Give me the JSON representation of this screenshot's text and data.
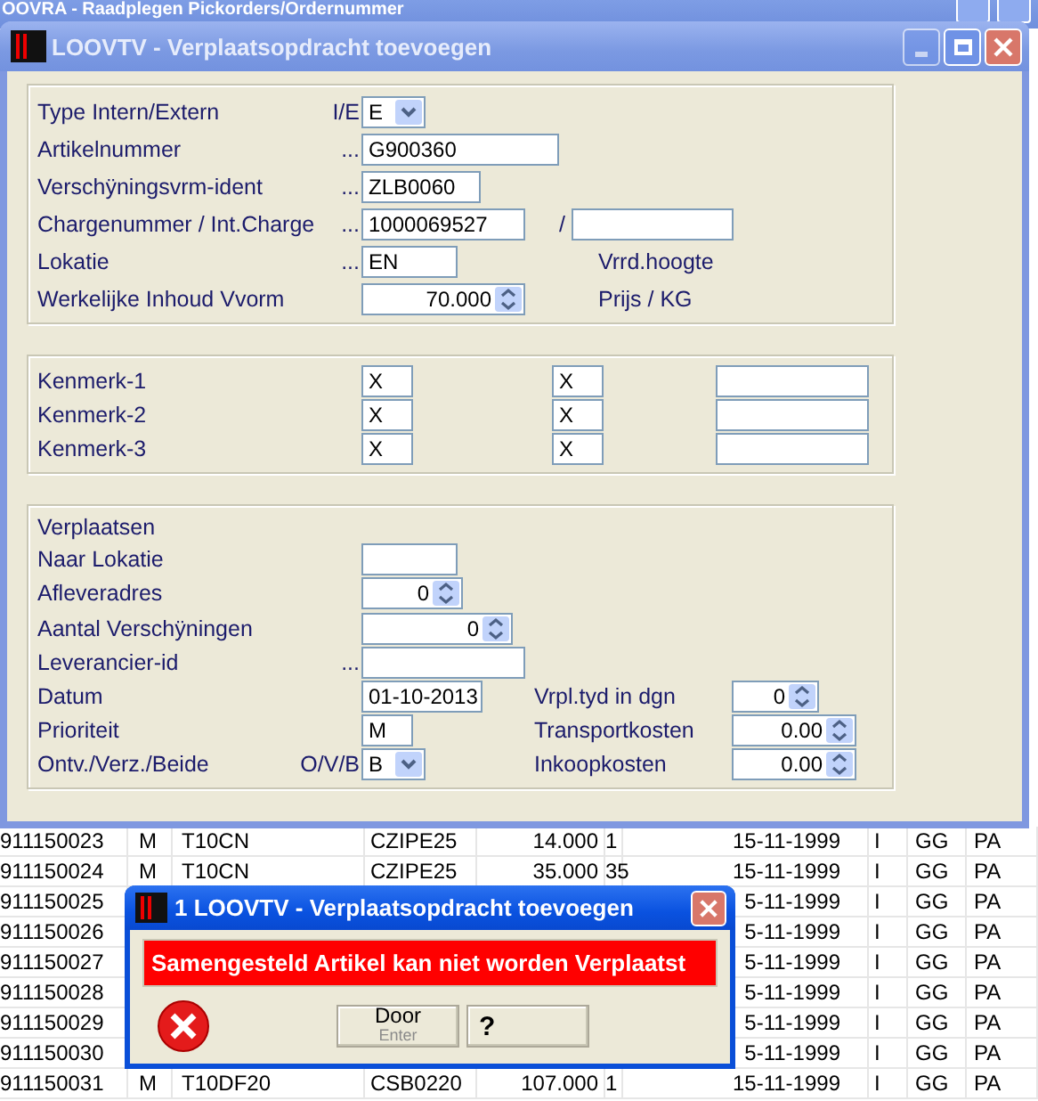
{
  "background_window": {
    "title": "OOVRA - Raadplegen Pickorders/Ordernummer"
  },
  "table": {
    "rows": [
      {
        "id": "911150023",
        "type": "M",
        "article": "T10CN",
        "code": "CZIPE25",
        "qty": "14.000",
        "count": "1",
        "date": "15-11-1999",
        "flag": "I",
        "group": "GG",
        "loc": "PA"
      },
      {
        "id": "911150024",
        "type": "M",
        "article": "T10CN",
        "code": "CZIPE25",
        "qty": "35.000",
        "count": "35",
        "date": "15-11-1999",
        "flag": "I",
        "group": "GG",
        "loc": "PA"
      },
      {
        "id": "911150025",
        "date": "5-11-1999",
        "flag": "I",
        "group": "GG",
        "loc": "PA"
      },
      {
        "id": "911150026",
        "date": "5-11-1999",
        "flag": "I",
        "group": "GG",
        "loc": "PA"
      },
      {
        "id": "911150027",
        "date": "5-11-1999",
        "flag": "I",
        "group": "GG",
        "loc": "PA"
      },
      {
        "id": "911150028",
        "date": "5-11-1999",
        "flag": "I",
        "group": "GG",
        "loc": "PA"
      },
      {
        "id": "911150029",
        "date": "5-11-1999",
        "flag": "I",
        "group": "GG",
        "loc": "PA"
      },
      {
        "id": "911150030",
        "date": "5-11-1999",
        "flag": "I",
        "group": "GG",
        "loc": "PA"
      },
      {
        "id": "911150031",
        "type": "M",
        "article": "T10DF20",
        "code": "CSB0220",
        "qty": "107.000",
        "count": "1",
        "date": "15-11-1999",
        "flag": "I",
        "group": "GG",
        "loc": "PA"
      }
    ]
  },
  "window": {
    "title": "LOOVTV - Verplaatsopdracht toevoegen"
  },
  "article_group": {
    "rows": [
      {
        "label": "Type Intern/Extern",
        "suffix": "I/E",
        "field": {
          "kind": "select",
          "value": "E"
        }
      },
      {
        "label": "Artikelnummer",
        "suffix": "...",
        "field": {
          "kind": "text",
          "value": "G900360"
        }
      },
      {
        "label": "Verschÿningsvrm-ident",
        "suffix": "...",
        "field": {
          "kind": "text",
          "value": "ZLB0060"
        }
      },
      {
        "label": "Chargenummer / Int.Charge",
        "suffix": "...",
        "field": {
          "kind": "text",
          "value": "1000069527"
        },
        "side": {
          "kind": "slash",
          "label": "/",
          "field": {
            "kind": "text"
          }
        }
      },
      {
        "label": "Lokatie",
        "suffix": "...",
        "field": {
          "kind": "text",
          "value": "EN"
        },
        "side": {
          "kind": "label",
          "label": "Vrrd.hoogte"
        }
      },
      {
        "label": "Werkelijke Inhoud Vvorm",
        "field": {
          "kind": "spin",
          "value": "70.000"
        },
        "side": {
          "kind": "label",
          "label": "Prijs / KG"
        }
      }
    ]
  },
  "kenmerk_group": {
    "rows": [
      {
        "label": "Kenmerk-1",
        "values": [
          "X",
          "X"
        ]
      },
      {
        "label": "Kenmerk-2",
        "values": [
          "X",
          "X"
        ]
      },
      {
        "label": "Kenmerk-3",
        "values": [
          "X",
          "X"
        ]
      }
    ]
  },
  "move_group": {
    "heading": "Verplaatsen",
    "rows": [
      {
        "label": "Naar Lokatie",
        "field": {
          "kind": "text"
        }
      },
      {
        "label": "Afleveradres",
        "field": {
          "kind": "spin",
          "value": "0"
        }
      },
      {
        "label": "Aantal Verschÿningen",
        "field": {
          "kind": "spin",
          "value": "0"
        }
      },
      {
        "label": "Leverancier-id",
        "suffix": "...",
        "field": {
          "kind": "text"
        }
      },
      {
        "label": "Datum",
        "field": {
          "kind": "text",
          "value": "01-10-2013"
        },
        "side": {
          "kind": "label",
          "label": "Vrpl.tyd in dgn",
          "field": {
            "kind": "spin",
            "value": "0"
          }
        }
      },
      {
        "label": "Prioriteit",
        "field": {
          "kind": "text",
          "value": "M"
        },
        "side": {
          "kind": "label",
          "label": "Transportkosten",
          "field": {
            "kind": "spin",
            "value": "0.00"
          }
        }
      },
      {
        "label": "Ontv./Verz./Beide",
        "suffix": "O/V/B",
        "field": {
          "kind": "select",
          "value": "B"
        },
        "side": {
          "kind": "label",
          "label": "Inkoopkosten",
          "field": {
            "kind": "spin",
            "value": "0.00"
          }
        }
      }
    ]
  },
  "message_dialog": {
    "title": "1 LOOVTV - Verplaatsopdracht toevoegen",
    "message": "Samengesteld Artikel kan niet worden Verplaatst",
    "ok_button": {
      "label": "Door",
      "hint": "Enter"
    },
    "help_button": {
      "label": "?"
    }
  }
}
